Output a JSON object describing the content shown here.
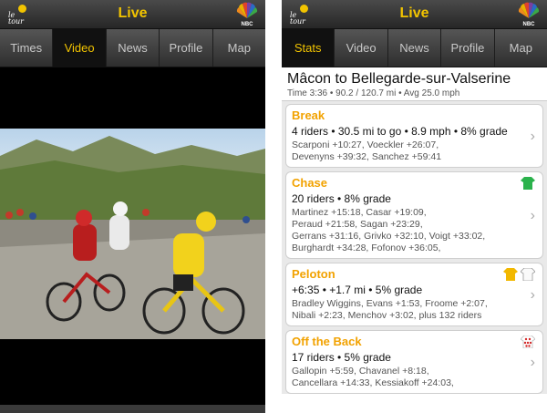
{
  "left": {
    "header_title": "Live",
    "tabs": [
      "Times",
      "Video",
      "News",
      "Profile",
      "Map"
    ],
    "active_tab": "Video"
  },
  "right": {
    "header_title": "Live",
    "tabs": [
      "Stats",
      "Video",
      "News",
      "Profile",
      "Map"
    ],
    "active_tab": "Stats",
    "stage_title": "Mâcon to Bellegarde-sur-Valserine",
    "stage_meta": "Time 3:36 • 90.2 / 120.7 mi • Avg 25.0 mph",
    "groups": [
      {
        "name": "Break",
        "headline": "4 riders • 30.5 mi to go • 8.9 mph • 8% grade",
        "lines": [
          "Scarponi +10:27, Voeckler +26:07,",
          "Devenyns +39:32, Sanchez +59:41"
        ],
        "jerseys": []
      },
      {
        "name": "Chase",
        "headline": "20 riders • 8% grade",
        "lines": [
          "Martinez +15:18, Casar +19:09,",
          "Peraud +21:58, Sagan +23:29,",
          "Gerrans +31:16, Grivko +32:10, Voigt +33:02,",
          "Burghardt +34:28, Fofonov +36:05,"
        ],
        "jerseys": [
          "green-jersey-icon"
        ]
      },
      {
        "name": "Peloton",
        "headline": "+6:35 • +1.7 mi • 5% grade",
        "lines": [
          "Bradley Wiggins, Evans +1:53, Froome +2:07,",
          "Nibali +2:23, Menchov +3:02, plus 132 riders"
        ],
        "jerseys": [
          "yellow-jersey-icon",
          "white-jersey-icon"
        ]
      },
      {
        "name": "Off the Back",
        "headline": "17 riders • 5% grade",
        "lines": [
          "Gallopin +5:59, Chavanel +8:18,",
          "Cancellara +14:33, Kessiakoff +24:03,"
        ],
        "jerseys": [
          "polka-dot-jersey-icon"
        ]
      }
    ]
  },
  "colors": {
    "accent": "#f2c400",
    "group_title": "#f2a200",
    "bar_dark": "#262626"
  }
}
